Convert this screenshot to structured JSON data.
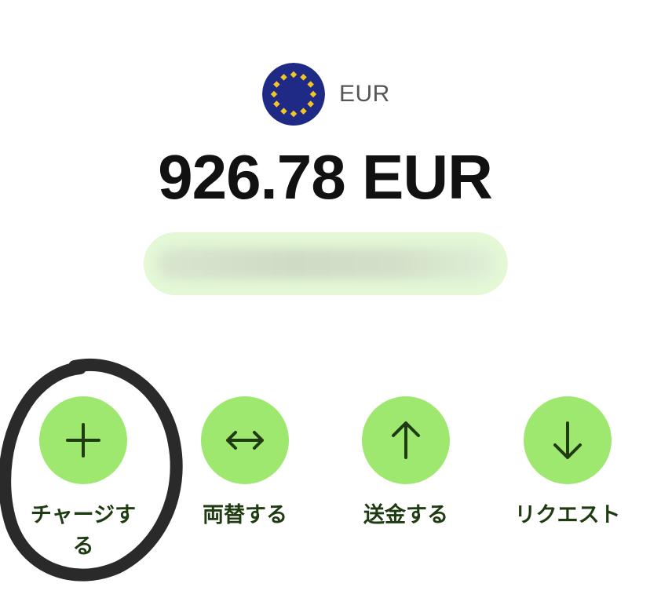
{
  "currency": {
    "flag_icon": "eu-flag-icon",
    "code": "EUR"
  },
  "balance": {
    "amount": "926.78 EUR"
  },
  "actions": [
    {
      "label": "チャージする",
      "icon": "plus-icon"
    },
    {
      "label": "両替する",
      "icon": "swap-arrows-icon"
    },
    {
      "label": "送金する",
      "icon": "arrow-up-icon"
    },
    {
      "label": "リクエスト",
      "icon": "arrow-down-icon"
    }
  ],
  "colors": {
    "action_bg": "#9fe870",
    "action_fg": "#1f3b11",
    "pill_bg": "#e4f7d6",
    "balance_text": "#111111",
    "flag_blue": "#1f2a87",
    "flag_star": "#f3c623"
  }
}
